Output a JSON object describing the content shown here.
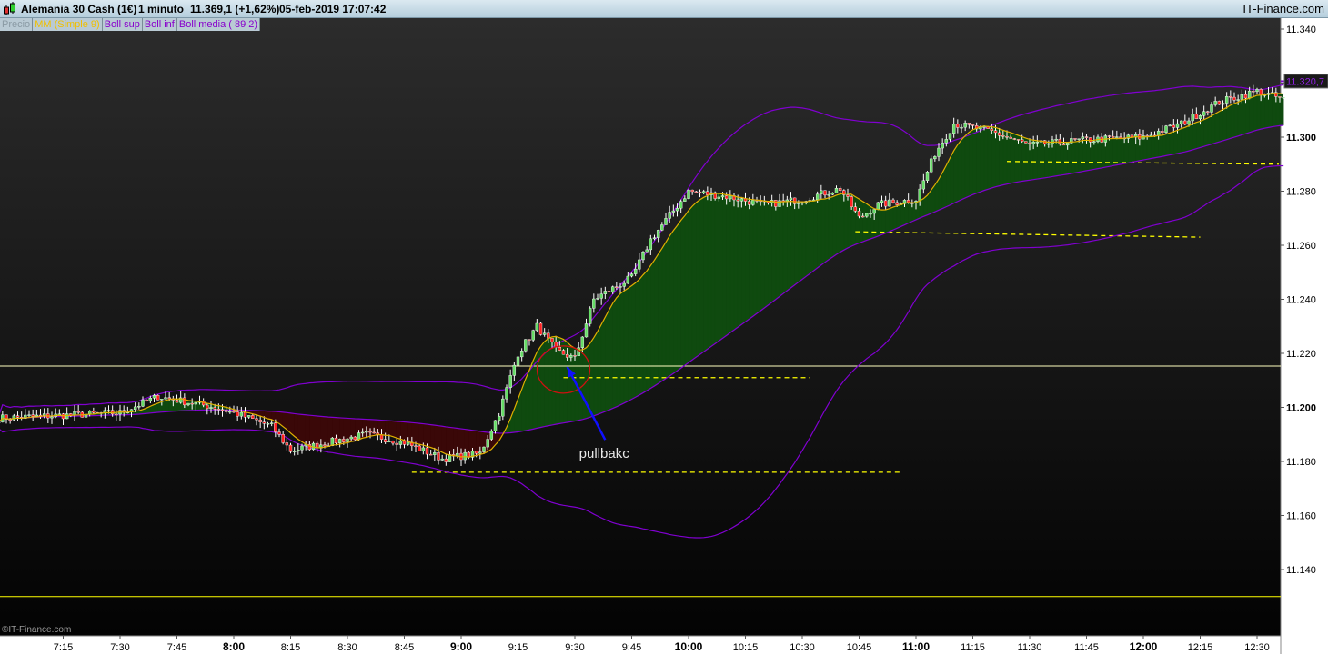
{
  "window": {
    "instrument": "Alemania 30 Cash (1€)",
    "timeframe": "1 minuto",
    "last_price": "11.369,1 (+1,62%)",
    "datetime": "05-feb-2019 17:07:42",
    "brand": "IT-Finance.com",
    "copyright": "©IT-Finance.com"
  },
  "legend": [
    {
      "label": "Precio",
      "color": "#8a9aa4"
    },
    {
      "label": "MM (Simple 9)",
      "color": "#f0c000"
    },
    {
      "label": "Boll sup",
      "color": "#8800cc"
    },
    {
      "label": "Boll inf",
      "color": "#8800cc"
    },
    {
      "label": "Boll media ( 89 2)",
      "color": "#8800cc"
    }
  ],
  "colors": {
    "up": "#66dd66",
    "down": "#ff2020",
    "wick": "#ffffff",
    "ma": "#e0b000",
    "bands": "#8000d0",
    "fill_above": "#0f4a0f",
    "fill_below": "#3a0808",
    "fill_ma_overlap": "#8a7a10",
    "level_line": "#ffff00",
    "annotation_circle": "#d01010",
    "arrow": "#1010ff"
  },
  "chart_data": {
    "type": "candlestick",
    "title": "",
    "y_ticks": [
      "11.340",
      "11.320",
      "11.300",
      "11.280",
      "11.260",
      "11.240",
      "11.220",
      "11.200",
      "11.180",
      "11.160",
      "11.140"
    ],
    "y_bold": [
      "11.300",
      "11.200"
    ],
    "ylim": [
      11.1052,
      11.3454
    ],
    "x_ticks": [
      "7:15",
      "7:30",
      "7:45",
      "8:00",
      "8:15",
      "8:30",
      "8:45",
      "9:00",
      "9:15",
      "9:30",
      "9:45",
      "10:00",
      "10:15",
      "10:30",
      "10:45",
      "11:00",
      "11:15",
      "11:30",
      "11:45",
      "12:00",
      "12:15",
      "12:30"
    ],
    "x_bold": [
      "8:00",
      "9:00",
      "10:00",
      "11:00",
      "12:00"
    ],
    "xlim": [
      "6:58",
      "12:37"
    ],
    "current_price_label": "11.320,7",
    "current_price": 11.3207,
    "close_path": [
      [
        "6:58",
        11.196
      ],
      [
        "7:30",
        11.198
      ],
      [
        "7:40",
        11.204
      ],
      [
        "7:55",
        11.2
      ],
      [
        "8:00",
        11.198
      ],
      [
        "8:10",
        11.193
      ],
      [
        "8:15",
        11.184
      ],
      [
        "8:25",
        11.187
      ],
      [
        "8:35",
        11.19
      ],
      [
        "8:45",
        11.187
      ],
      [
        "8:55",
        11.181
      ],
      [
        "9:05",
        11.183
      ],
      [
        "9:10",
        11.198
      ],
      [
        "9:15",
        11.22
      ],
      [
        "9:20",
        11.23
      ],
      [
        "9:25",
        11.221
      ],
      [
        "9:30",
        11.218
      ],
      [
        "9:35",
        11.24
      ],
      [
        "9:45",
        11.248
      ],
      [
        "9:50",
        11.262
      ],
      [
        "10:00",
        11.28
      ],
      [
        "10:10",
        11.278
      ],
      [
        "10:20",
        11.275
      ],
      [
        "10:30",
        11.277
      ],
      [
        "10:40",
        11.281
      ],
      [
        "10:45",
        11.27
      ],
      [
        "10:50",
        11.275
      ],
      [
        "11:00",
        11.277
      ],
      [
        "11:05",
        11.294
      ],
      [
        "11:10",
        11.305
      ],
      [
        "11:20",
        11.302
      ],
      [
        "11:30",
        11.297
      ],
      [
        "11:45",
        11.299
      ],
      [
        "12:00",
        11.3
      ],
      [
        "12:10",
        11.305
      ],
      [
        "12:20",
        11.313
      ],
      [
        "12:30",
        11.317
      ],
      [
        "12:37",
        11.314
      ]
    ],
    "indicators": {
      "ma_period": 9,
      "boll_period": 89,
      "boll_k": 2
    },
    "horizontal_lines": [
      {
        "price": 11.13,
        "style": "solid",
        "color": "#ffff00"
      },
      {
        "price": 11.2153,
        "style": "solid",
        "color": "#ffffc0"
      }
    ],
    "dashed_levels": [
      {
        "from": "9:27",
        "to": "10:32",
        "p1": 11.211,
        "p2": 11.211
      },
      {
        "from": "8:47",
        "to": "10:56",
        "p1": 11.176,
        "p2": 11.176
      },
      {
        "from": "10:44",
        "to": "12:15",
        "p1": 11.265,
        "p2": 11.263
      },
      {
        "from": "11:24",
        "to": "12:37",
        "p1": 11.291,
        "p2": 11.29
      }
    ],
    "annotations": [
      {
        "type": "circle",
        "time": "9:27",
        "price": 11.214
      },
      {
        "type": "arrow",
        "from_time": "9:38",
        "from_price": 11.188,
        "to_time": "9:28",
        "to_price": 11.215
      },
      {
        "type": "text",
        "text": "pullbakc",
        "time": "9:34",
        "price": 11.183
      }
    ]
  }
}
